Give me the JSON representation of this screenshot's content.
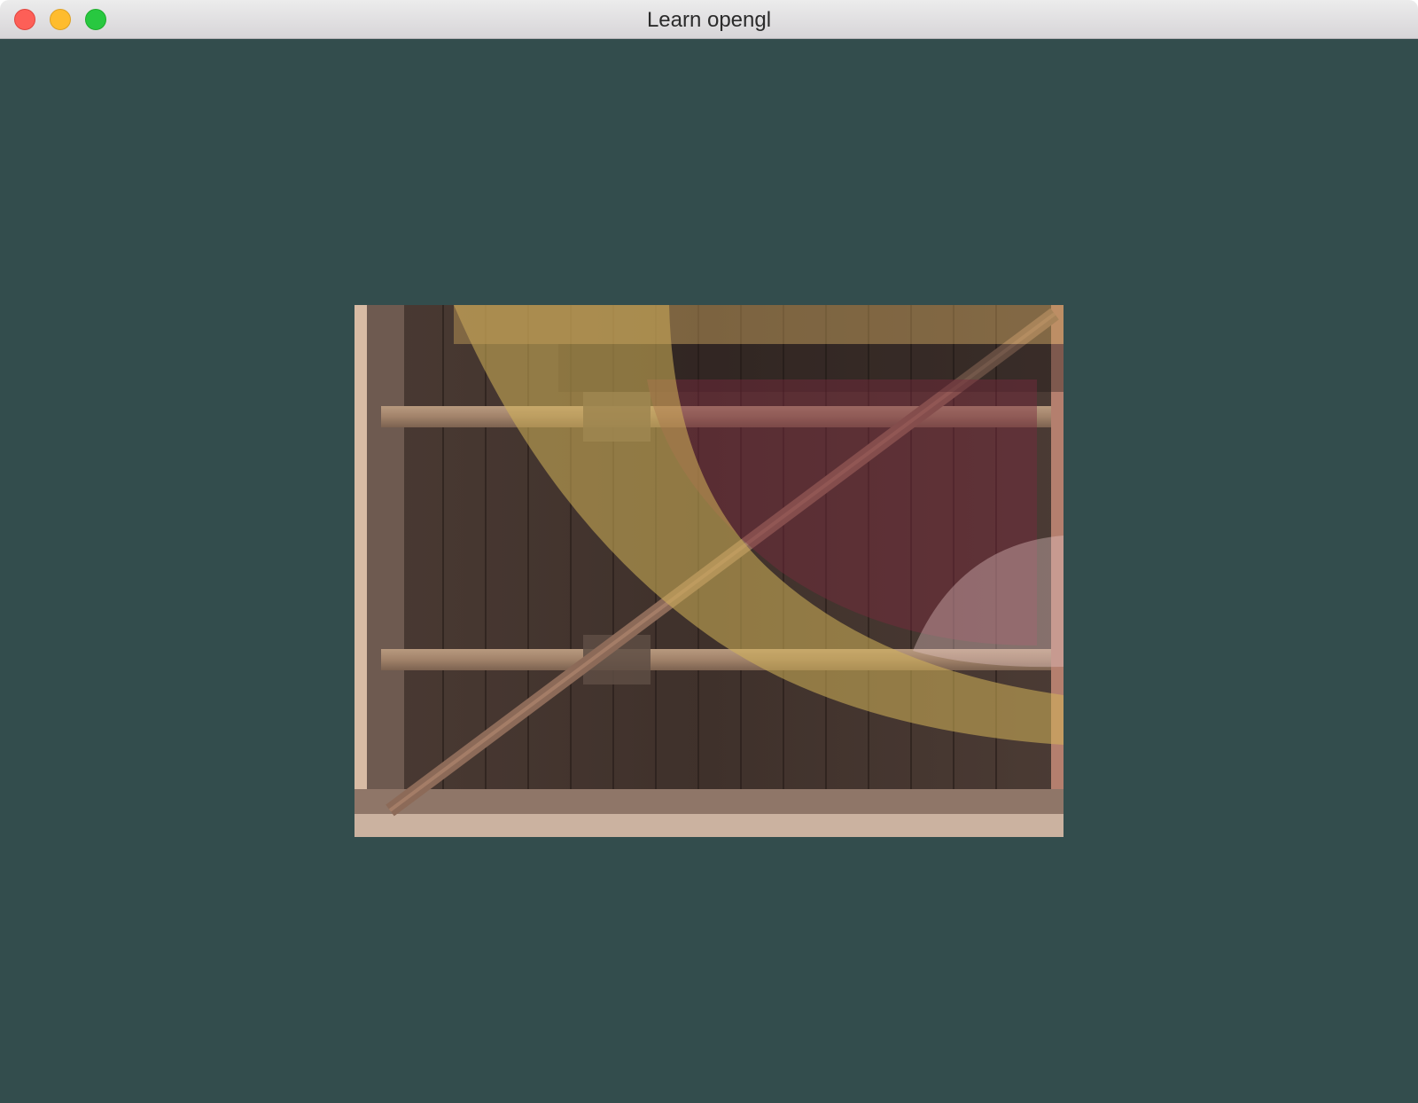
{
  "window": {
    "title": "Learn opengl"
  },
  "colors": {
    "clear_color": "#334d4d",
    "titlebar": "#e3e1e4",
    "close": "#fd5f57",
    "minimize": "#febc2e",
    "zoom": "#28c840"
  },
  "scene": {
    "texture": "wooden-container-blended-with-face",
    "icons": [
      "close-button",
      "minimize-button",
      "zoom-button"
    ]
  }
}
